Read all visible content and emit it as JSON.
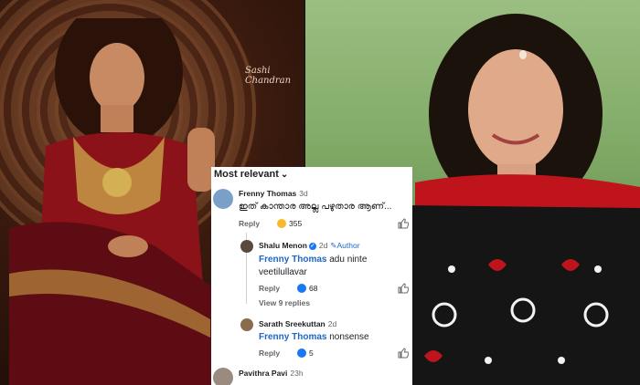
{
  "left_photo": {
    "signature": "Sashi Chandran"
  },
  "comments": {
    "sort_label": "Most relevant",
    "items": [
      {
        "author": "Frenny Thomas",
        "time": "3d",
        "text": "ഇത് കാന്താര അല്ല പഴുതാര ആണ്...",
        "reply_label": "Reply",
        "reaction_count": "355",
        "reaction_icon": "laugh-emoji"
      },
      {
        "author": "Shalu Menon",
        "time": "2d",
        "badge": "Author",
        "mention": "Frenny Thomas",
        "text": "adu ninte",
        "text_line2": "veetilullavar",
        "reply_label": "Reply",
        "reaction_count": "68",
        "reaction_icon": "thumbs-up",
        "view_replies": "View 9 replies"
      },
      {
        "author": "Sarath Sreekuttan",
        "time": "2d",
        "mention": "Frenny Thomas",
        "text": "nonsense",
        "reply_label": "Reply",
        "reaction_count": "5",
        "reaction_icon": "thumbs-up"
      },
      {
        "author": "Pavithra Pavi",
        "time": "23h"
      }
    ]
  },
  "colors": {
    "link": "#1e66c8",
    "saree_red": "#a8141e",
    "kurta_black": "#151515"
  }
}
